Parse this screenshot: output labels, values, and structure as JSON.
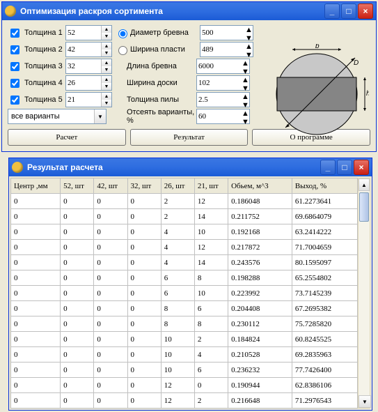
{
  "window1": {
    "title": "Оптимизация раскроя сортимента",
    "thickness_label": "Толщина",
    "thickness": [
      {
        "label": "Толщина 1",
        "value": "52",
        "checked": true
      },
      {
        "label": "Толщина 2",
        "value": "42",
        "checked": true
      },
      {
        "label": "Толщина 3",
        "value": "32",
        "checked": true
      },
      {
        "label": "Толщина 4",
        "value": "26",
        "checked": true
      },
      {
        "label": "Толщина 5",
        "value": "21",
        "checked": true
      }
    ],
    "diameter_label": "Диаметр бревна",
    "diameter_value": "500",
    "widthface_label": "Ширина пласти",
    "widthface_value": "489",
    "length_label": "Длина бревна",
    "length_value": "6000",
    "boardwidth_label": "Ширина доски",
    "boardwidth_value": "102",
    "sawthick_label": "Толщина пилы",
    "sawthick_value": "2.5",
    "filter_label": "Отсеять варианты, %",
    "filter_value": "60",
    "variants_select": "все варианты",
    "btn_calc": "Расчет",
    "btn_result": "Результат",
    "btn_about": "О программе",
    "diag": {
      "b": "b",
      "D": "D",
      "h": "h"
    }
  },
  "window2": {
    "title": "Результат расчета",
    "columns": [
      "Центр ,мм",
      "52, шт",
      "42, шт",
      "32, шт",
      "26, шт",
      "21, шт",
      "Обьем, м^3",
      "Выход, %"
    ],
    "rows": [
      [
        "0",
        "0",
        "0",
        "0",
        "2",
        "12",
        "0.186048",
        "61.2273641"
      ],
      [
        "0",
        "0",
        "0",
        "0",
        "2",
        "14",
        "0.211752",
        "69.6864079"
      ],
      [
        "0",
        "0",
        "0",
        "0",
        "4",
        "10",
        "0.192168",
        "63.2414222"
      ],
      [
        "0",
        "0",
        "0",
        "0",
        "4",
        "12",
        "0.217872",
        "71.7004659"
      ],
      [
        "0",
        "0",
        "0",
        "0",
        "4",
        "14",
        "0.243576",
        "80.1595097"
      ],
      [
        "0",
        "0",
        "0",
        "0",
        "6",
        "8",
        "0.198288",
        "65.2554802"
      ],
      [
        "0",
        "0",
        "0",
        "0",
        "6",
        "10",
        "0.223992",
        "73.7145239"
      ],
      [
        "0",
        "0",
        "0",
        "0",
        "8",
        "6",
        "0.204408",
        "67.2695382"
      ],
      [
        "0",
        "0",
        "0",
        "0",
        "8",
        "8",
        "0.230112",
        "75.7285820"
      ],
      [
        "0",
        "0",
        "0",
        "0",
        "10",
        "2",
        "0.184824",
        "60.8245525"
      ],
      [
        "0",
        "0",
        "0",
        "0",
        "10",
        "4",
        "0.210528",
        "69.2835963"
      ],
      [
        "0",
        "0",
        "0",
        "0",
        "10",
        "6",
        "0.236232",
        "77.7426400"
      ],
      [
        "0",
        "0",
        "0",
        "0",
        "12",
        "0",
        "0.190944",
        "62.8386106"
      ],
      [
        "0",
        "0",
        "0",
        "0",
        "12",
        "2",
        "0.216648",
        "71.2976543"
      ]
    ]
  },
  "chart_data": {
    "type": "table",
    "columns": [
      "Центр ,мм",
      "52, шт",
      "42, шт",
      "32, шт",
      "26, шт",
      "21, шт",
      "Обьем, м^3",
      "Выход, %"
    ],
    "rows": [
      [
        0,
        0,
        0,
        0,
        2,
        12,
        0.186048,
        61.2273641
      ],
      [
        0,
        0,
        0,
        0,
        2,
        14,
        0.211752,
        69.6864079
      ],
      [
        0,
        0,
        0,
        0,
        4,
        10,
        0.192168,
        63.2414222
      ],
      [
        0,
        0,
        0,
        0,
        4,
        12,
        0.217872,
        71.7004659
      ],
      [
        0,
        0,
        0,
        0,
        4,
        14,
        0.243576,
        80.1595097
      ],
      [
        0,
        0,
        0,
        0,
        6,
        8,
        0.198288,
        65.2554802
      ],
      [
        0,
        0,
        0,
        0,
        6,
        10,
        0.223992,
        73.7145239
      ],
      [
        0,
        0,
        0,
        0,
        8,
        6,
        0.204408,
        67.2695382
      ],
      [
        0,
        0,
        0,
        0,
        8,
        8,
        0.230112,
        75.728582
      ],
      [
        0,
        0,
        0,
        0,
        10,
        2,
        0.184824,
        60.8245525
      ],
      [
        0,
        0,
        0,
        0,
        10,
        4,
        0.210528,
        69.2835963
      ],
      [
        0,
        0,
        0,
        0,
        10,
        6,
        0.236232,
        77.74264
      ],
      [
        0,
        0,
        0,
        0,
        12,
        0,
        0.190944,
        62.8386106
      ],
      [
        0,
        0,
        0,
        0,
        12,
        2,
        0.216648,
        71.2976543
      ]
    ]
  }
}
